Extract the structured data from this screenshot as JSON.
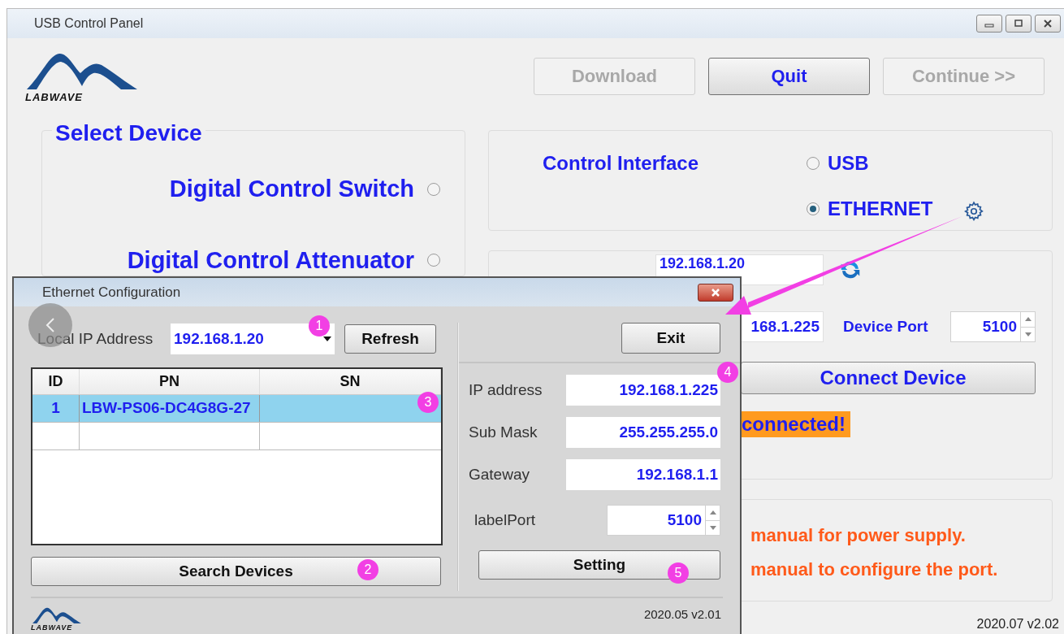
{
  "window": {
    "title": "USB Control Panel",
    "logo_text": "LABWAVE"
  },
  "toolbar": [
    {
      "label": "Download",
      "disabled": true
    },
    {
      "label": "Quit",
      "disabled": false
    },
    {
      "label": "Continue >>",
      "disabled": true
    }
  ],
  "select_device": {
    "title": "Select Device",
    "options": [
      {
        "label": "Digital Control Switch",
        "selected": false
      },
      {
        "label": "Digital Control Attenuator",
        "selected": false
      }
    ]
  },
  "control_interface": {
    "label": "Control Interface",
    "options": [
      {
        "label": "USB",
        "selected": false
      },
      {
        "label": "ETHERNET",
        "selected": true
      }
    ]
  },
  "connection": {
    "local_ip": "192.168.1.20",
    "device_ip": "168.1.225",
    "device_port_label": "Device Port",
    "device_port": "5100",
    "connect_button": "Connect Device",
    "status": "connected!"
  },
  "notes": [
    "manual for power supply.",
    "manual to configure the port."
  ],
  "version": "2020.07 v2.02",
  "dialog": {
    "title": "Ethernet Configuration",
    "local_ip_label": "Local IP Address",
    "local_ip": "192.168.1.20",
    "refresh_button": "Refresh",
    "exit_button": "Exit",
    "table": {
      "columns": [
        "ID",
        "PN",
        "SN"
      ],
      "rows": [
        {
          "id": "1",
          "pn": "LBW-PS06-DC4G8G-27",
          "selected": true
        }
      ]
    },
    "fields": [
      {
        "label": "IP address",
        "value": "192.168.1.225",
        "kind": "text"
      },
      {
        "label": "Sub Mask",
        "value": "255.255.255.0",
        "kind": "text"
      },
      {
        "label": "Gateway",
        "value": "192.168.1.1",
        "kind": "text"
      },
      {
        "label": "labelPort",
        "value": "5100",
        "kind": "spinner"
      }
    ],
    "search_button": "Search Devices",
    "setting_button": "Setting",
    "version": "2020.05 v2.01",
    "logo_text": "LABWAVE"
  },
  "annotations": [
    "1",
    "2",
    "3",
    "4",
    "5"
  ]
}
